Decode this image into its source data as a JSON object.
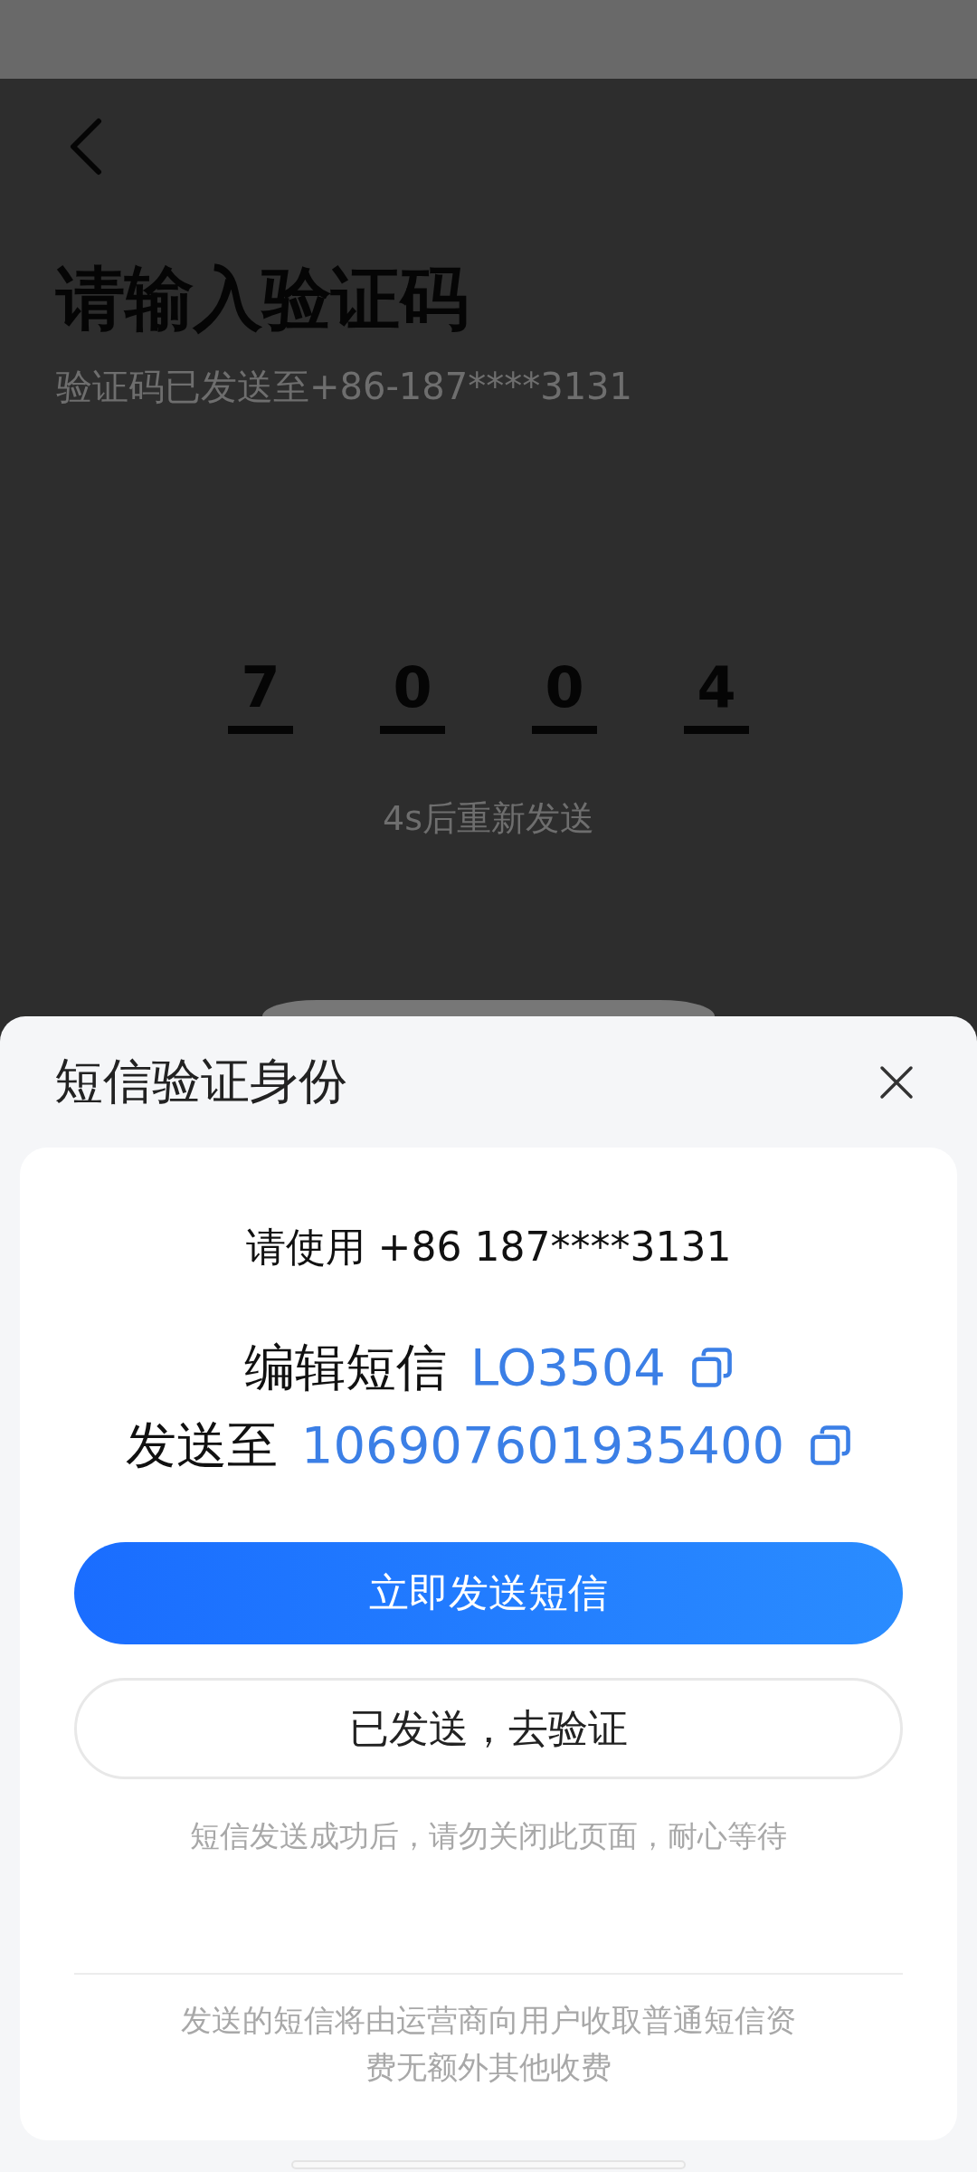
{
  "page": {
    "title": "请输入验证码",
    "subtitle": "验证码已发送至+86-187****3131",
    "code_digits": [
      "7",
      "0",
      "0",
      "4"
    ],
    "resend": "4s后重新发送"
  },
  "sheet": {
    "title": "短信验证身份",
    "use_line": "请使用 +86 187****3131",
    "rows": [
      {
        "label": "编辑短信",
        "value": "LO3504"
      },
      {
        "label": "发送至",
        "value": "106907601935400"
      }
    ],
    "primary_button": "立即发送短信",
    "secondary_button": "已发送，去验证",
    "note": "短信发送成功后，请勿关闭此页面，耐心等待",
    "footer": "发送的短信将由运营商向用户收取普通短信资费无额外其他收费"
  }
}
